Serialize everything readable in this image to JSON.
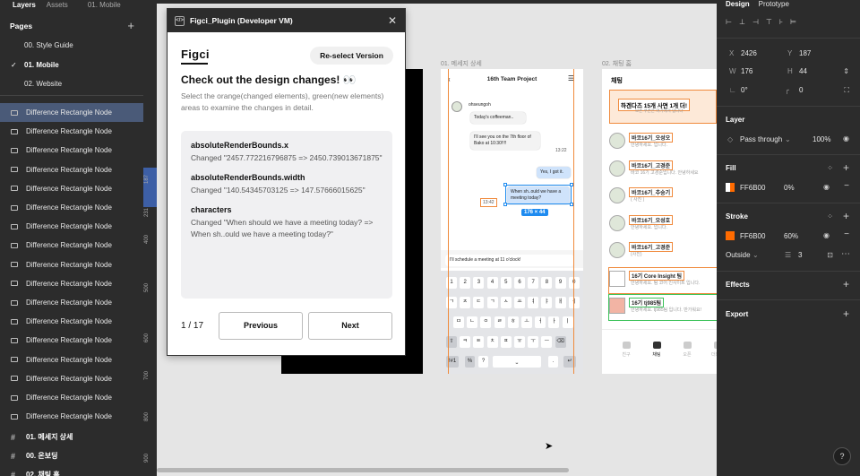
{
  "left": {
    "tabs": [
      "Layers",
      "Assets",
      "01. Mobile"
    ],
    "pages_title": "Pages",
    "pages": [
      "00. Style Guide",
      "01. Mobile",
      "02. Website"
    ],
    "selected_page": "01. Mobile",
    "layer_label": "Difference Rectangle Node",
    "layer_count": 17,
    "frames": [
      "01. 메세지 상세",
      "00. 온보딩",
      "02. 채팅 홈"
    ]
  },
  "ruler": {
    "marks": [
      "187",
      "231",
      "400",
      "500",
      "600",
      "700",
      "800",
      "900"
    ]
  },
  "plugin": {
    "title": "Figci_Plugin (Developer VM)",
    "logo": "Figci",
    "reselect": "Re-select Version",
    "heading": "Check out the design changes! 👀",
    "subtext": "Select the orange(changed elements), green(new elements) areas to examine the changes in detail.",
    "changes": [
      {
        "prop": "absoluteRenderBounds.x",
        "text": "Changed \"2457.772216796875 => 2450.739013671875\""
      },
      {
        "prop": "absoluteRenderBounds.width",
        "text": "Changed \"140.54345703125 => 147.57666015625\""
      },
      {
        "prop": "characters",
        "text": "Changed \"When should we have a meeting today? => When sh..ould we have a meeting today?\""
      }
    ],
    "pager": "1 / 17",
    "prev": "Previous",
    "next": "Next"
  },
  "frames": {
    "chat_label": "01. 메세지 상세",
    "list_label": "02. 채팅 홈",
    "chat_title": "16th Team Project",
    "sender": "ohseungoh",
    "msg1": "Today's coffeeman..",
    "msg2": "I'll see you on the 7th floor of Bako at 10:30!!!!",
    "time1": "13:22",
    "msg3": "Yes, I got it.",
    "msg4": "When sh..ould we have a meeting today?",
    "time2": "13:42",
    "size_badge": "176 × 44",
    "input_text": "I'll schedule a meeting at 11 o'clock!",
    "kb_row1": [
      "1",
      "2",
      "3",
      "4",
      "5",
      "6",
      "7",
      "8",
      "9",
      "0"
    ],
    "kb_row2": [
      "ㄱ",
      "ㅈ",
      "ㄷ",
      "ㄱ",
      "ㅅ",
      "ㅛ",
      "ㅕ",
      "ㅑ",
      "ㅐ",
      "ㅔ"
    ],
    "kb_row3": [
      "ㅁ",
      "ㄴ",
      "ㅇ",
      "ㄹ",
      "ㅎ",
      "ㅗ",
      "ㅓ",
      "ㅏ",
      "ㅣ"
    ],
    "kb_row4": [
      "⇧",
      "ㅋ",
      "ㅌ",
      "ㅊ",
      "ㅍ",
      "ㅠ",
      "ㅜ",
      "ㅡ",
      "⌫"
    ],
    "kb_row5": [
      "!#1",
      "%",
      "?",
      "⎵",
      ".",
      "↵"
    ],
    "list_title": "채팅",
    "banner": "하겐다즈 15개 사면 1개 더!",
    "banner_sub": "보존 쿠폰은 여기에서 입니다",
    "rows": [
      {
        "name": "바코16기_오성오",
        "msg": "안녕하세요. 입니다."
      },
      {
        "name": "바코16기_고경준",
        "msg": "바코 16기 고경준입니다. 안녕하세요"
      },
      {
        "name": "바코16기_추숭기",
        "msg": "( 사진 )"
      },
      {
        "name": "바코16기_오성호",
        "msg": "안녕하세요. 입니다."
      },
      {
        "name": "바코16기_고경준",
        "msg": "(사진)"
      },
      {
        "name": "16기 Core Insight 팀",
        "msg": "안녕하세요. 팀 코어 인사이트 입니다."
      },
      {
        "name": "16기 tj985팀",
        "msg": "안녕하세요. tj985팀 입니다. 반가워요!"
      }
    ],
    "tabbar": [
      "친구",
      "채팅",
      "오픈",
      "더보기"
    ]
  },
  "right": {
    "tabs": [
      "Design",
      "Prototype"
    ],
    "x_label": "X",
    "x": "2426",
    "y_label": "Y",
    "y": "187",
    "w_label": "W",
    "w": "176",
    "h_label": "H",
    "h": "44",
    "rotation": "0°",
    "radius": "0",
    "layer_title": "Layer",
    "blend": "Pass through",
    "opacity": "100%",
    "fill_title": "Fill",
    "fill_hex": "FF6B00",
    "fill_opacity": "0%",
    "stroke_title": "Stroke",
    "stroke_hex": "FF6B00",
    "stroke_opacity": "60%",
    "stroke_pos": "Outside",
    "stroke_width": "3",
    "effects_title": "Effects",
    "export_title": "Export",
    "help": "?",
    "accent": "#FF6B00"
  }
}
